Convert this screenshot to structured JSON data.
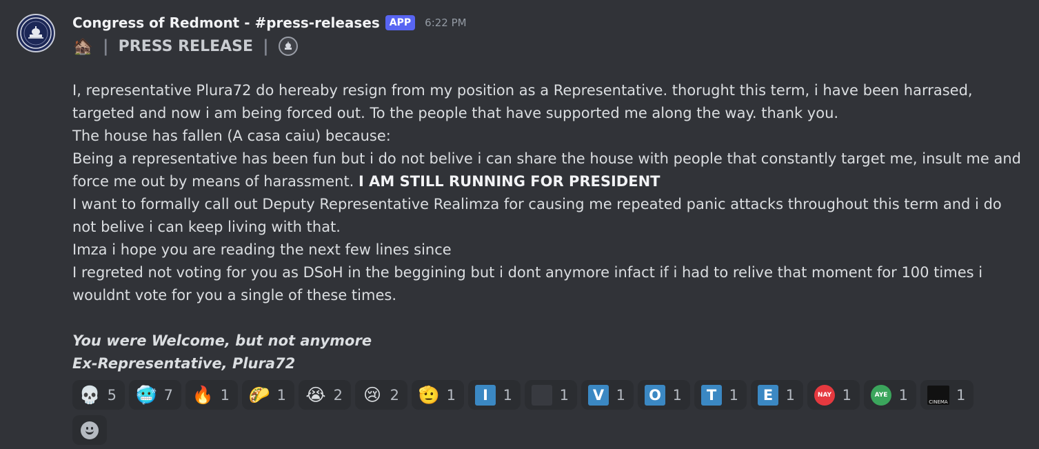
{
  "message": {
    "author": "Congress of Redmont - #press-releases",
    "badge": "APP",
    "timestamp": "6:22 PM",
    "avatar_icon": "capitol-seal-icon",
    "press_line": {
      "emoji": "🏚️",
      "separator": "|",
      "title": "PRESS RELEASE",
      "seal_icon": "capitol-seal-icon"
    },
    "paragraphs": [
      "I, representative Plura72 do hereaby resign from my position as a Representative. thorught this term, i have been harrased, targeted and now i am being forced out. To the people that have supported me along the way. thank you.",
      "The house has fallen (A casa caiu) because:",
      "Being a representative has been fun but i do not belive i can share the house with people that constantly target me, insult me and force me out by means of harassment.",
      "I AM STILL RUNNING FOR PRESIDENT",
      "I want to formally call out Deputy Representative Realimza for causing me repeated panic attacks throughout this term and i do not belive i can keep living with that.",
      "Imza i hope you are reading the next few lines since",
      "I regreted not voting for you as DSoH in the beggining but i dont anymore infact if i had to relive that moment for 100 times i wouldnt vote for you a single of these times."
    ],
    "signature": [
      "You were Welcome, but not anymore",
      "Ex-Representative, Plura72"
    ]
  },
  "reactions": [
    {
      "emoji": "💀",
      "count": "5"
    },
    {
      "emoji": "🥶",
      "count": "7"
    },
    {
      "emoji": "🔥",
      "count": "1"
    },
    {
      "emoji": "🌮",
      "count": "1"
    },
    {
      "emoji": "😭",
      "count": "2"
    },
    {
      "emoji": "😢",
      "count": "2"
    },
    {
      "emoji": "🫡",
      "count": "1"
    },
    {
      "emoji": "I",
      "count": "1"
    },
    {
      "emoji": "",
      "count": "1"
    },
    {
      "emoji": "V",
      "count": "1"
    },
    {
      "emoji": "O",
      "count": "1"
    },
    {
      "emoji": "T",
      "count": "1"
    },
    {
      "emoji": "E",
      "count": "1"
    },
    {
      "emoji": "NAY",
      "count": "1",
      "color": "#e5393f"
    },
    {
      "emoji": "AYE",
      "count": "1",
      "color": "#3ba55c"
    },
    {
      "emoji": "CINEMA",
      "count": "1"
    }
  ],
  "add_reaction_icon": "add-reaction-smiley-icon",
  "colors": {
    "background": "#313338",
    "app_badge": "#5865f2",
    "letter_tile": "#3b88c3"
  }
}
